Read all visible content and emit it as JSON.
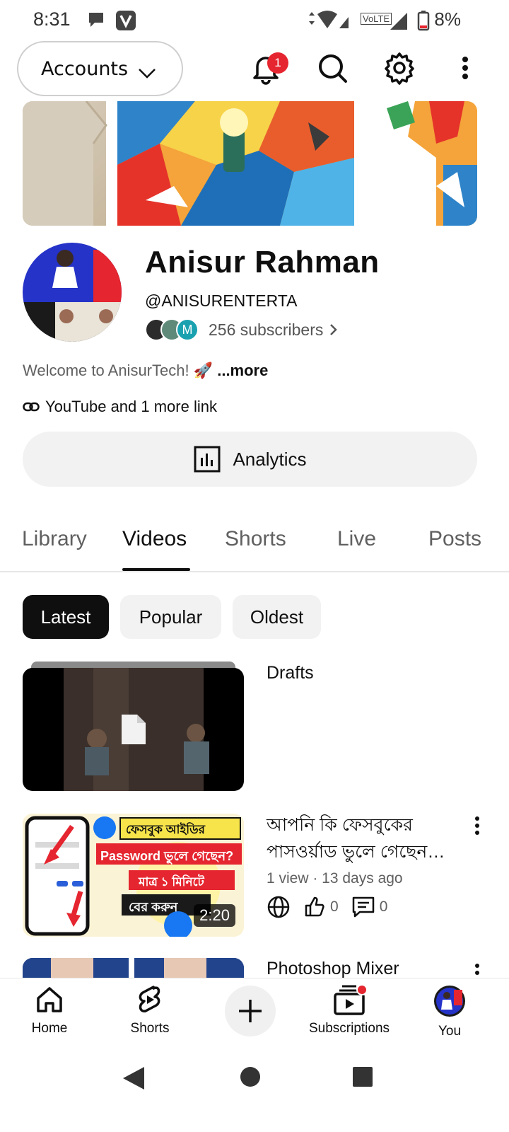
{
  "status_bar": {
    "time": "8:31",
    "battery": "8%",
    "volte": "VoLTE"
  },
  "top_bar": {
    "accounts_label": "Accounts",
    "notification_count": "1"
  },
  "channel": {
    "name": "Anisur Rahman",
    "handle": "@ANISURENTERTA",
    "subscribers": "256 subscribers",
    "subscriber_avatar_letter": "M",
    "description": "Welcome to AnisurTech! 🚀",
    "more_label": "...more",
    "links_label": "YouTube and 1 more link",
    "analytics_label": "Analytics"
  },
  "tabs": [
    "Library",
    "Videos",
    "Shorts",
    "Live",
    "Posts"
  ],
  "active_tab": "Videos",
  "chips": [
    "Latest",
    "Popular",
    "Oldest"
  ],
  "videos": [
    {
      "title": "Drafts"
    },
    {
      "title": "আপনি কি ফেসবুকের পাসওর্য়াড ভুলে গেছেন…",
      "meta": "1 view · 13 days ago",
      "duration": "2:20",
      "likes": "0",
      "comments": "0",
      "thumb_text_1": "ফেসবুক আইডির",
      "thumb_text_2": "Password ভুলে গেছেন?",
      "thumb_text_3": "মাত্র ১ মিনিটে",
      "thumb_text_4": "বের করুন"
    },
    {
      "title": "Photoshop Mixer"
    }
  ],
  "bottom_nav": {
    "home": "Home",
    "shorts": "Shorts",
    "subscriptions": "Subscriptions",
    "you": "You"
  },
  "colors": {
    "accent_red": "#e5252f",
    "chip_bg": "#f2f2f2",
    "text": "#0f0f0f",
    "secondary_text": "#606060"
  }
}
